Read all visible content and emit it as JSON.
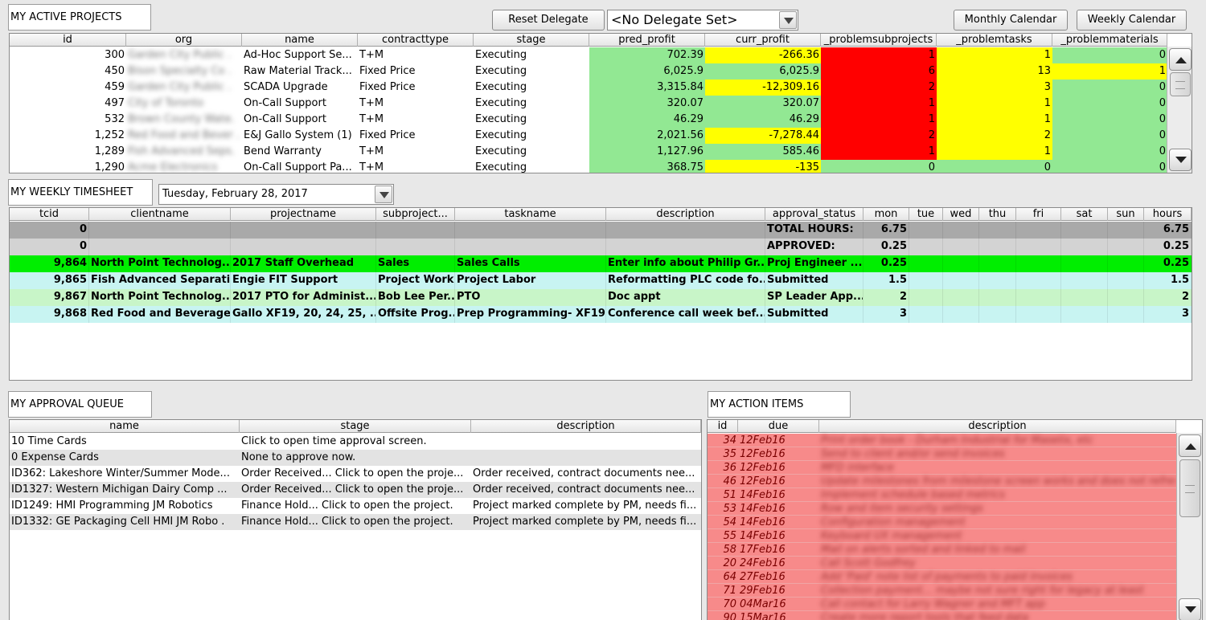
{
  "projects_panel": {
    "title": "MY ACTIVE PROJECTS"
  },
  "toolbar": {
    "reset_delegate": "Reset Delegate",
    "delegate_value": "<No Delegate Set>",
    "monthly_calendar": "Monthly Calendar",
    "weekly_calendar": "Weekly Calendar"
  },
  "projects": {
    "columns": [
      "id",
      "org",
      "name",
      "contracttype",
      "stage",
      "pred_profit",
      "curr_profit",
      "_problemsubprojects",
      "_problemtasks",
      "_problemmaterials"
    ],
    "rows": [
      {
        "id": "300",
        "org": "Garden City Public .",
        "name": "Ad-Hoc Support Se...",
        "contracttype": "T+M",
        "stage": "Executing",
        "pred": "702.39",
        "curr": "-266.36",
        "psub": "1",
        "ptask": "1",
        "pmat": "0",
        "curr_c": "y",
        "psub_c": "rd",
        "ptask_c": "y",
        "pmat_c": "g"
      },
      {
        "id": "450",
        "org": "Bison Specialty Co .",
        "name": "Raw Material Track...",
        "contracttype": "Fixed Price",
        "stage": "Executing",
        "pred": "6,025.9",
        "curr": "6,025.9",
        "psub": "6",
        "ptask": "13",
        "pmat": "1",
        "curr_c": "g",
        "psub_c": "rd",
        "ptask_c": "y",
        "pmat_c": "y"
      },
      {
        "id": "459",
        "org": "Garden City Public .",
        "name": "SCADA Upgrade",
        "contracttype": "Fixed Price",
        "stage": "Executing",
        "pred": "3,315.84",
        "curr": "-12,309.16",
        "psub": "2",
        "ptask": "3",
        "pmat": "0",
        "curr_c": "y",
        "psub_c": "rd",
        "ptask_c": "y",
        "pmat_c": "g"
      },
      {
        "id": "497",
        "org": "City of Toronto",
        "name": "On-Call Support",
        "contracttype": "T+M",
        "stage": "Executing",
        "pred": "320.07",
        "curr": "320.07",
        "psub": "1",
        "ptask": "1",
        "pmat": "0",
        "curr_c": "g",
        "psub_c": "rd",
        "ptask_c": "y",
        "pmat_c": "g"
      },
      {
        "id": "532",
        "org": "Brown County Wate.",
        "name": "On-Call Support",
        "contracttype": "T+M",
        "stage": "Executing",
        "pred": "46.29",
        "curr": "46.29",
        "psub": "1",
        "ptask": "1",
        "pmat": "0",
        "curr_c": "g",
        "psub_c": "rd",
        "ptask_c": "y",
        "pmat_c": "g"
      },
      {
        "id": "1,252",
        "org": "Red Food and Bever .",
        "name": "E&J Gallo System (1)",
        "contracttype": "Fixed Price",
        "stage": "Executing",
        "pred": "2,021.56",
        "curr": "-7,278.44",
        "psub": "2",
        "ptask": "2",
        "pmat": "0",
        "curr_c": "y",
        "psub_c": "rd",
        "ptask_c": "y",
        "pmat_c": "g"
      },
      {
        "id": "1,289",
        "org": "Fish Advanced Seps.",
        "name": "Bend Warranty",
        "contracttype": "T+M",
        "stage": "Executing",
        "pred": "1,127.96",
        "curr": "585.46",
        "psub": "1",
        "ptask": "1",
        "pmat": "0",
        "curr_c": "g",
        "psub_c": "rd",
        "ptask_c": "y",
        "pmat_c": "g"
      },
      {
        "id": "1,290",
        "org": "Acme Electronics",
        "name": "On-Call Support Pa...",
        "contracttype": "T+M",
        "stage": "Executing",
        "pred": "368.75",
        "curr": "-135",
        "psub": "0",
        "ptask": "0",
        "pmat": "0",
        "curr_c": "y",
        "psub_c": "g",
        "ptask_c": "g",
        "pmat_c": "g"
      }
    ]
  },
  "timesheet_panel": {
    "title": "MY WEEKLY TIMESHEET",
    "date": "Tuesday, February 28, 2017"
  },
  "timesheet": {
    "columns": [
      "tcid",
      "clientname",
      "projectname",
      "subproject...",
      "taskname",
      "description",
      "approval_status",
      "mon",
      "tue",
      "wed",
      "thu",
      "fri",
      "sat",
      "sun",
      "hours"
    ],
    "rows": [
      {
        "tcid": "0",
        "client": "",
        "project": "",
        "sub": "",
        "task": "",
        "desc": "",
        "status": "TOTAL HOURS:",
        "mon": "6.75",
        "hours": "6.75"
      },
      {
        "tcid": "0",
        "client": "",
        "project": "",
        "sub": "",
        "task": "",
        "desc": "",
        "status": "APPROVED:",
        "mon": "0.25",
        "hours": "0.25"
      },
      {
        "tcid": "9,864",
        "client": "North Point Technolog...",
        "project": "2017 Staff Overhead",
        "sub": "Sales",
        "task": "Sales Calls",
        "desc": "Enter info about Philip Gr...",
        "status": "Proj Engineer ...",
        "mon": "0.25",
        "hours": "0.25"
      },
      {
        "tcid": "9,865",
        "client": "Fish Advanced Separati...",
        "project": "Engie FIT Support",
        "sub": "Project Work",
        "task": "Project Labor",
        "desc": "Reformatting PLC code fo...",
        "status": "Submitted",
        "mon": "1.5",
        "hours": "1.5"
      },
      {
        "tcid": "9,867",
        "client": "North Point Technolog...",
        "project": "2017 PTO for Administ...",
        "sub": "Bob Lee Per...",
        "task": "PTO",
        "desc": "Doc appt",
        "status": "SP Leader App...",
        "mon": "2",
        "hours": "2"
      },
      {
        "tcid": "9,868",
        "client": "Red Food and Beverage",
        "project": "Gallo XF19, 20, 24, 25, ...",
        "sub": "Offsite Prog...",
        "task": "Prep Programming- XF19",
        "desc": "Conference call week bef...",
        "status": "Submitted",
        "mon": "3",
        "hours": "3"
      }
    ]
  },
  "approval_panel": {
    "title": "MY APPROVAL QUEUE"
  },
  "approval": {
    "columns": [
      "name",
      "stage",
      "description"
    ],
    "rows": [
      {
        "name": "10 Time Cards",
        "stage": "Click to open time approval screen.",
        "desc": ""
      },
      {
        "name": "0 Expense Cards",
        "stage": "None to approve now.",
        "desc": ""
      },
      {
        "name": "ID362: Lakeshore Winter/Summer Mode...",
        "stage": "Order Received... Click to open the proje...",
        "desc": "Order received, contract documents nee..."
      },
      {
        "name": "ID1327: Western Michigan Dairy Comp ...",
        "stage": "Order Received... Click to open the proje...",
        "desc": "Order received, contract documents nee..."
      },
      {
        "name": "ID1249: HMI Programming JM Robotics",
        "stage": "Finance Hold... Click to open the project.",
        "desc": "Project marked complete by PM, needs fi..."
      },
      {
        "name": "ID1332: GE Packaging Cell HMI JM Robo .",
        "stage": "Finance Hold... Click to open the project.",
        "desc": "Project marked complete by PM, needs fi..."
      }
    ]
  },
  "actions_panel": {
    "title": "MY ACTION ITEMS"
  },
  "actions": {
    "columns": [
      "id",
      "due",
      "description"
    ],
    "rows": [
      {
        "id": "34",
        "due": "12Feb16",
        "desc": "Print order book - Durham Industrial for Maselix, etc"
      },
      {
        "id": "35",
        "due": "12Feb16",
        "desc": "Send to client and/or send invoices"
      },
      {
        "id": "36",
        "due": "12Feb16",
        "desc": "MFD interface"
      },
      {
        "id": "46",
        "due": "12Feb16",
        "desc": "Update milestones from milestone screen works and does not refresh ..."
      },
      {
        "id": "51",
        "due": "14Feb16",
        "desc": "Implement schedule based metrics"
      },
      {
        "id": "53",
        "due": "14Feb16",
        "desc": "Row and item security settings"
      },
      {
        "id": "54",
        "due": "14Feb16",
        "desc": "Configuration management"
      },
      {
        "id": "55",
        "due": "14Feb16",
        "desc": "Keyboard UX management"
      },
      {
        "id": "58",
        "due": "17Feb16",
        "desc": "Mail on alerts sorted and linked to mail"
      },
      {
        "id": "20",
        "due": "24Feb16",
        "desc": "Call Scott Godfrey"
      },
      {
        "id": "64",
        "due": "27Feb16",
        "desc": "Add 'Paid' note list of payments to paid invoices"
      },
      {
        "id": "71",
        "due": "29Feb16",
        "desc": "Collection payment... maybe not sure right for legacy at least"
      },
      {
        "id": "70",
        "due": "04Mar16",
        "desc": "Call contact for Larry Wagner and MFT app"
      },
      {
        "id": "90",
        "due": "15Mar16",
        "desc": "Create more report tools that feed data"
      }
    ]
  }
}
